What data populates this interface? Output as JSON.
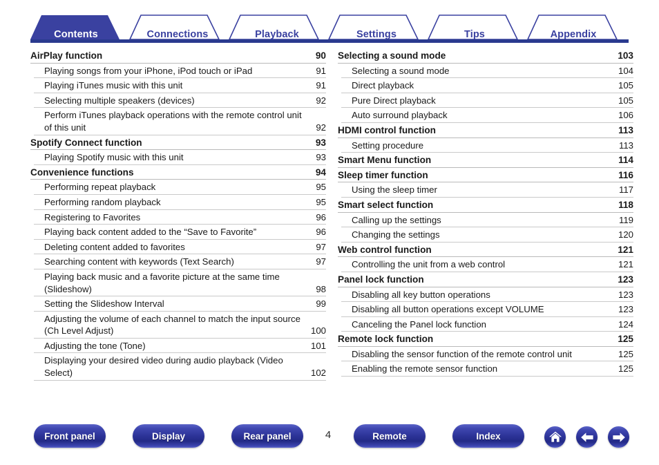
{
  "tabs": [
    {
      "label": "Contents",
      "active": true
    },
    {
      "label": "Connections",
      "active": false
    },
    {
      "label": "Playback",
      "active": false
    },
    {
      "label": "Settings",
      "active": false
    },
    {
      "label": "Tips",
      "active": false
    },
    {
      "label": "Appendix",
      "active": false
    }
  ],
  "toc": {
    "left": [
      {
        "level": 1,
        "title": "AirPlay function",
        "page": "90"
      },
      {
        "level": 2,
        "title": "Playing songs from your iPhone, iPod touch or iPad",
        "page": "91"
      },
      {
        "level": 2,
        "title": "Playing iTunes music with this unit",
        "page": "91"
      },
      {
        "level": 2,
        "title": "Selecting multiple speakers (devices)",
        "page": "92"
      },
      {
        "level": 2,
        "title": "Perform iTunes playback operations with the remote control unit of this unit",
        "page": "92"
      },
      {
        "level": 1,
        "title": "Spotify Connect function",
        "page": "93"
      },
      {
        "level": 2,
        "title": "Playing Spotify music with this unit",
        "page": "93"
      },
      {
        "level": 1,
        "title": "Convenience functions",
        "page": "94"
      },
      {
        "level": 2,
        "title": "Performing repeat playback",
        "page": "95"
      },
      {
        "level": 2,
        "title": "Performing random playback",
        "page": "95"
      },
      {
        "level": 2,
        "title": "Registering to Favorites",
        "page": "96"
      },
      {
        "level": 2,
        "title": "Playing back content added to the “Save to Favorite”",
        "page": "96"
      },
      {
        "level": 2,
        "title": "Deleting content added to favorites",
        "page": "97"
      },
      {
        "level": 2,
        "title": "Searching content with keywords (Text Search)",
        "page": "97"
      },
      {
        "level": 2,
        "title": "Playing back music and a favorite picture at the same time (Slideshow)",
        "page": "98"
      },
      {
        "level": 2,
        "title": "Setting the Slideshow Interval",
        "page": "99"
      },
      {
        "level": 2,
        "title": "Adjusting the volume of each channel to match the input source (Ch Level Adjust)",
        "page": "100"
      },
      {
        "level": 2,
        "title": "Adjusting the tone (Tone)",
        "page": "101"
      },
      {
        "level": 2,
        "title": "Displaying your desired video during audio playback (Video Select)",
        "page": "102"
      }
    ],
    "right": [
      {
        "level": 1,
        "title": "Selecting a sound mode",
        "page": "103"
      },
      {
        "level": 2,
        "title": "Selecting a sound mode",
        "page": "104"
      },
      {
        "level": 2,
        "title": "Direct playback",
        "page": "105"
      },
      {
        "level": 2,
        "title": "Pure Direct playback",
        "page": "105"
      },
      {
        "level": 2,
        "title": "Auto surround playback",
        "page": "106"
      },
      {
        "level": 1,
        "title": "HDMI control function",
        "page": "113"
      },
      {
        "level": 2,
        "title": "Setting procedure",
        "page": "113"
      },
      {
        "level": 1,
        "title": "Smart Menu function",
        "page": "114"
      },
      {
        "level": 1,
        "title": "Sleep timer function",
        "page": "116"
      },
      {
        "level": 2,
        "title": "Using the sleep timer",
        "page": "117"
      },
      {
        "level": 1,
        "title": "Smart select function",
        "page": "118"
      },
      {
        "level": 2,
        "title": "Calling up the settings",
        "page": "119"
      },
      {
        "level": 2,
        "title": "Changing the settings",
        "page": "120"
      },
      {
        "level": 1,
        "title": "Web control function",
        "page": "121"
      },
      {
        "level": 2,
        "title": "Controlling the unit from a web control",
        "page": "121"
      },
      {
        "level": 1,
        "title": "Panel lock function",
        "page": "123"
      },
      {
        "level": 2,
        "title": "Disabling all key button operations",
        "page": "123"
      },
      {
        "level": 2,
        "title": "Disabling all button operations except VOLUME",
        "page": "123"
      },
      {
        "level": 2,
        "title": "Canceling the Panel lock function",
        "page": "124"
      },
      {
        "level": 1,
        "title": "Remote lock function",
        "page": "125"
      },
      {
        "level": 2,
        "title": "Disabling the sensor function of the remote control unit",
        "page": "125"
      },
      {
        "level": 2,
        "title": "Enabling the remote sensor function",
        "page": "125"
      }
    ]
  },
  "footer": {
    "buttons": [
      {
        "label": "Front panel"
      },
      {
        "label": "Display"
      },
      {
        "label": "Rear panel"
      },
      {
        "label": "Remote"
      },
      {
        "label": "Index"
      }
    ],
    "icons": [
      {
        "name": "home-icon"
      },
      {
        "name": "arrow-left-icon"
      },
      {
        "name": "arrow-right-icon"
      }
    ],
    "page_number": "4"
  },
  "colors": {
    "tab_blue": "#3a41a0",
    "tab_bar": "#2a3a8f",
    "button_blue": "#2b3296",
    "rule_gray": "#c0c0c0",
    "text": "#1a1a1a"
  }
}
